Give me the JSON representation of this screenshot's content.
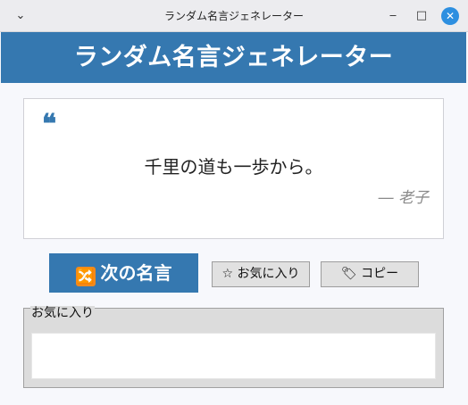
{
  "window": {
    "title": "ランダム名言ジェネレーター",
    "menu_glyph": "⌄",
    "minimize_glyph": "‒",
    "maximize_glyph": "□",
    "close_glyph": "✕"
  },
  "header": {
    "title": "ランダム名言ジェネレーター"
  },
  "quote": {
    "mark": "❝",
    "text": "千里の道も一歩から。",
    "author": "― 老子"
  },
  "actions": {
    "next_icon": "🔀",
    "next_label": "次の名言",
    "favorite_label": "☆ お気に入り",
    "copy_label": "🏷 コピー"
  },
  "favorites": {
    "label": "お気に入り",
    "items": []
  },
  "colors": {
    "accent": "#3578b0",
    "shuffle_icon": "#f28a1c",
    "author_text": "#8a8a8a"
  }
}
